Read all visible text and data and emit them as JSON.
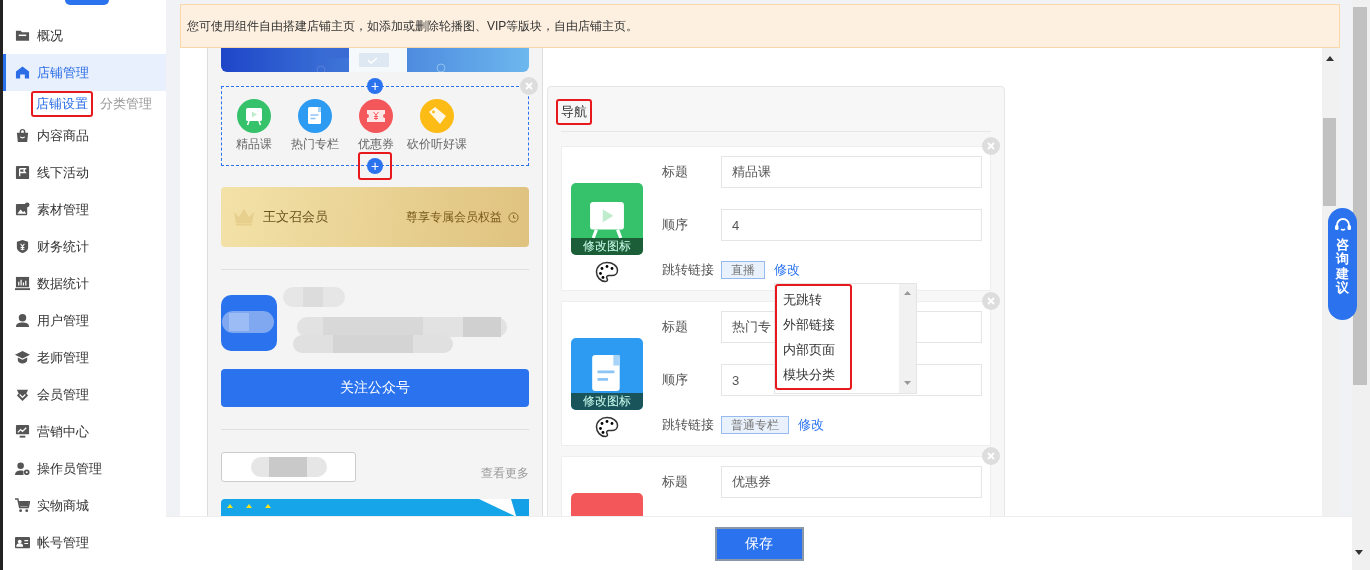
{
  "sidebar": {
    "items": [
      {
        "label": "概况",
        "selected": false
      },
      {
        "label": "店铺管理",
        "selected": true,
        "children": [
          {
            "label": "店铺设置",
            "selected": true,
            "highlighted": true
          },
          {
            "label": "分类管理",
            "selected": false,
            "highlighted": false
          }
        ]
      },
      {
        "label": "内容商品",
        "selected": false
      },
      {
        "label": "线下活动",
        "selected": false
      },
      {
        "label": "素材管理",
        "selected": false
      },
      {
        "label": "财务统计",
        "selected": false
      },
      {
        "label": "数据统计",
        "selected": false
      },
      {
        "label": "用户管理",
        "selected": false
      },
      {
        "label": "老师管理",
        "selected": false
      },
      {
        "label": "会员管理",
        "selected": false
      },
      {
        "label": "营销中心",
        "selected": false
      },
      {
        "label": "操作员管理",
        "selected": false
      },
      {
        "label": "实物商城",
        "selected": false
      },
      {
        "label": "帐号管理",
        "selected": false
      }
    ]
  },
  "notice": "您可使用组件自由搭建店铺主页，如添加或删除轮播图、VIP等版块，自由店铺主页。",
  "phone_preview": {
    "nav_block": {
      "items": [
        {
          "label": "精品课"
        },
        {
          "label": "热门专栏"
        },
        {
          "label": "优惠券"
        },
        {
          "label": "砍价听好课"
        }
      ],
      "add_buttons": [
        {
          "label": "+",
          "highlighted": false
        },
        {
          "label": "+",
          "highlighted": true
        }
      ]
    },
    "member_card": {
      "name": "王文召会员",
      "benefit": "尊享专属会员权益"
    },
    "follow_button": "关注公众号",
    "more_link": "查看更多"
  },
  "nav_editor": {
    "title": "导航",
    "highlighted": true,
    "items": [
      {
        "icon_label": "修改图标",
        "fields": [
          {
            "label": "标题",
            "value": "精品课"
          },
          {
            "label": "顺序",
            "value": "4"
          }
        ],
        "link": {
          "label": "跳转链接",
          "tag": "直播",
          "action": "修改"
        }
      },
      {
        "icon_label": "修改图标",
        "fields": [
          {
            "label": "标题",
            "value": "热门专"
          },
          {
            "label": "顺序",
            "value": "3"
          }
        ],
        "link": {
          "label": "跳转链接",
          "tag": "普通专栏",
          "action": "修改"
        }
      },
      {
        "fields": [
          {
            "label": "标题",
            "value": "优惠券"
          }
        ]
      }
    ],
    "link_menu": {
      "options": [
        "无跳转",
        "外部链接",
        "内部页面",
        "模块分类"
      ],
      "highlighted": true
    }
  },
  "consult_button": "咨询建议",
  "save_button": "保存"
}
